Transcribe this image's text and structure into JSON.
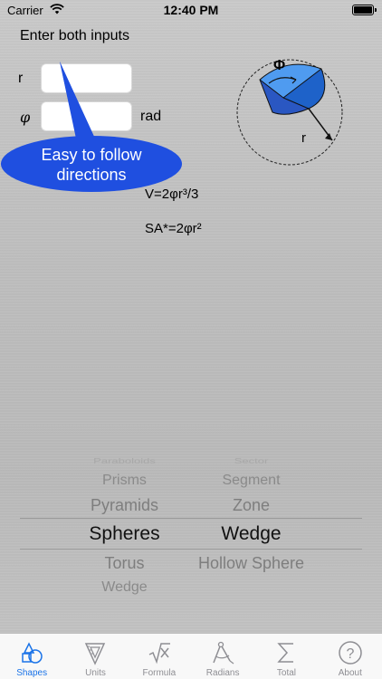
{
  "status_bar": {
    "carrier": "Carrier",
    "time": "12:40 PM"
  },
  "form": {
    "instruction": "Enter both inputs",
    "r_label": "r",
    "phi_label": "φ",
    "unit_label": "rad",
    "r_value": "",
    "phi_value": ""
  },
  "callout": {
    "line1": "Easy to follow",
    "line2": "directions",
    "color": "#1f4fe0"
  },
  "diagram": {
    "phi_symbol": "Φ",
    "r_symbol": "r",
    "wedge_color": "#2e6fd8"
  },
  "formulas": {
    "volume": "V=2φr³/3",
    "surface_area": "SA*=2φr²"
  },
  "picker": {
    "column1": [
      "Paraboloids",
      "Prisms",
      "Pyramids",
      "Spheres",
      "Torus",
      "Wedge"
    ],
    "column2": [
      "Sector",
      "Segment",
      "Zone",
      "Wedge",
      "Hollow Sphere"
    ],
    "selected1": "Spheres",
    "selected2": "Wedge"
  },
  "tabs": [
    {
      "label": "Shapes",
      "icon": "shapes-icon",
      "active": true
    },
    {
      "label": "Units",
      "icon": "ruler-triangle-icon",
      "active": false
    },
    {
      "label": "Formula",
      "icon": "square-root-icon",
      "active": false
    },
    {
      "label": "Radians",
      "icon": "compass-icon",
      "active": false
    },
    {
      "label": "Total",
      "icon": "sigma-icon",
      "active": false
    },
    {
      "label": "About",
      "icon": "question-icon",
      "active": false
    }
  ],
  "colors": {
    "accent": "#1a73e8",
    "callout": "#1f4fe0"
  }
}
